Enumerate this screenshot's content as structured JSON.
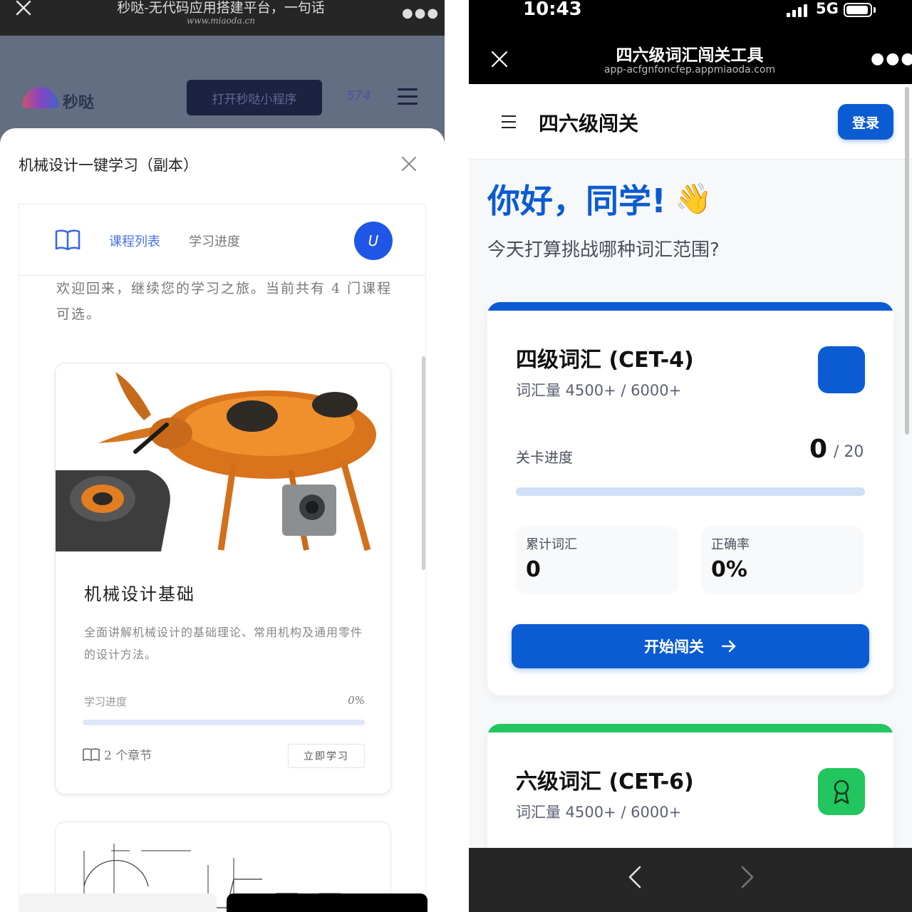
{
  "left": {
    "topbar": {
      "title": "秒哒-无代码应用搭建平台，一句话",
      "url": "www.miaoda.cn"
    },
    "header": {
      "logo_text": "秒哒",
      "open_button": "打开秒哒小程序",
      "count": "574"
    },
    "sheet": {
      "title": "机械设计一键学习（副本）",
      "nav": {
        "tab_courses": "课程列表",
        "tab_progress": "学习进度",
        "avatar_letter": "U"
      },
      "welcome": "欢迎回来，继续您的学习之旅。当前共有 4 门课程可选。",
      "course": {
        "name": "机械设计基础",
        "description": "全面讲解机械设计的基础理论、常用机构及通用零件的设计方法。",
        "progress_label": "学习进度",
        "progress_value": "0%",
        "progress_fraction": 0,
        "chapters": "2 个章节",
        "study_button": "立即学习"
      }
    }
  },
  "right": {
    "status": {
      "time": "10:43",
      "network": "5G"
    },
    "wx": {
      "title": "四六级词汇闯关工具",
      "url": "app-acfgnfoncfep.appmiaoda.com"
    },
    "header": {
      "app_name": "四六级闯关",
      "login_button": "登录"
    },
    "greeting": "你好，同学!",
    "greeting_emoji": "👋",
    "subgreeting": "今天打算挑战哪种词汇范围?",
    "cet4": {
      "title": "四级词汇 (CET-4)",
      "subtitle": "词汇量 4500+ / 6000+",
      "progress_label": "关卡进度",
      "progress_current": "0",
      "progress_total": "/ 20",
      "progress_fraction": 0,
      "stat1_label": "累计词汇",
      "stat1_value": "0",
      "stat2_label": "正确率",
      "stat2_value": "0%",
      "start_button": "开始闯关",
      "accent": "#0b5bd3"
    },
    "cet6": {
      "title": "六级词汇 (CET-6)",
      "subtitle": "词汇量 4500+ / 6000+",
      "accent": "#22c55e",
      "badge_icon": "award-icon"
    }
  }
}
